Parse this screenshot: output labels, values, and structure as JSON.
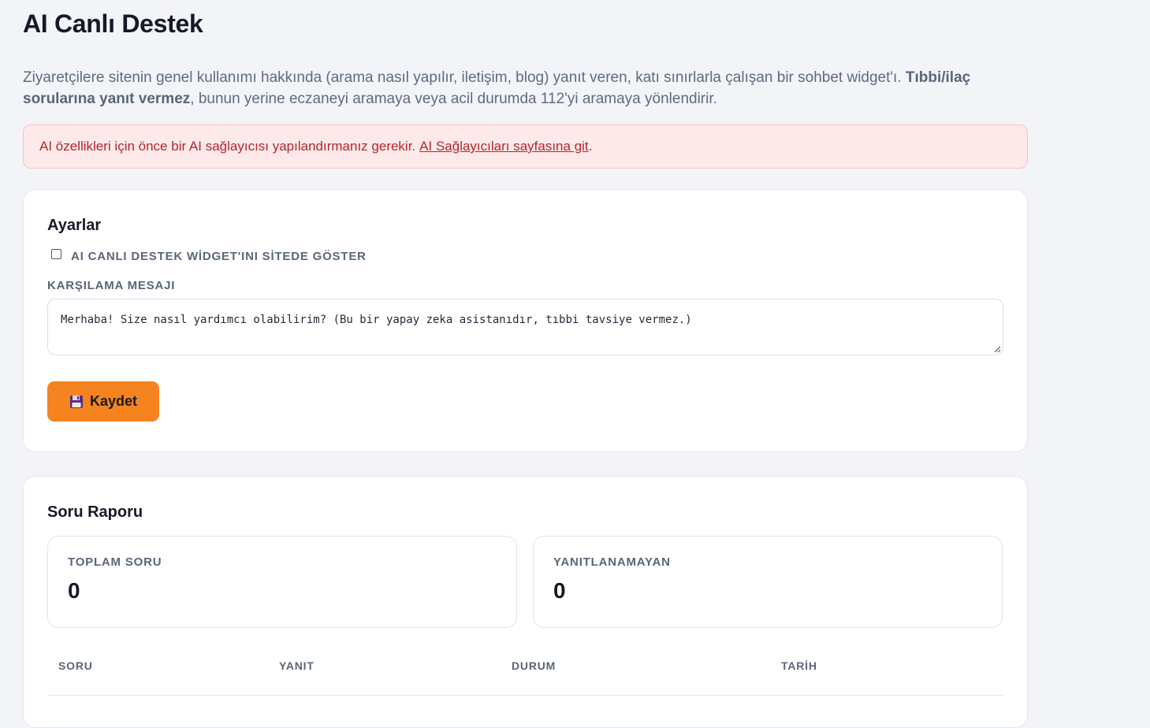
{
  "page": {
    "title": "AI Canlı Destek",
    "intro_text": "Ziyaretçilere sitenin genel kullanımı hakkında (arama nasıl yapılır, iletişim, blog) yanıt veren, katı sınırlarla çalışan bir sohbet widget'ı.",
    "intro_bold": "Tıbbi/ilaç sorularına yanıt vermez",
    "intro_tail": ", bunun yerine eczaneyi aramaya veya acil durumda 112'yi aramaya yönlendirir."
  },
  "alert": {
    "text": "AI özellikleri için önce bir AI sağlayıcısı yapılandırmanız gerekir.",
    "link_label": "AI Sağlayıcıları sayfasına git",
    "trailing": "."
  },
  "settings": {
    "title": "Ayarlar",
    "show_widget_label": "AI CANLI DESTEK WİDGET'INI SİTEDE GÖSTER",
    "show_widget_checked": false,
    "welcome_label": "KARŞILAMA MESAJI",
    "welcome_value": "Merhaba! Size nasıl yardımcı olabilirim? (Bu bir yapay zeka asistanıdır, tıbbi tavsiye vermez.)",
    "save_label": "Kaydet",
    "save_icon": "floppy-disk-icon"
  },
  "report": {
    "title": "Soru Raporu",
    "stats": [
      {
        "label": "TOPLAM SORU",
        "value": "0"
      },
      {
        "label": "YANITLANAMAYAN",
        "value": "0"
      }
    ],
    "columns": [
      "SORU",
      "YANIT",
      "DURUM",
      "TARİH"
    ]
  },
  "colors": {
    "accent": "#f5831f",
    "alert_bg": "#fee9ea",
    "alert_text": "#b4262c",
    "background": "#f3f4f8"
  }
}
